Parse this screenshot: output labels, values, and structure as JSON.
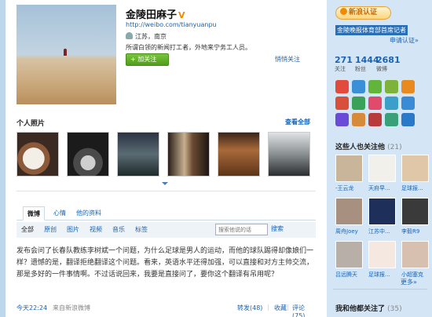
{
  "profile": {
    "name": "金陵田麻子",
    "verified_mark": "V",
    "url": "http://weibo.com/tianyuanpu",
    "location": "江苏，南京",
    "bio": "所谓白领的新闻打工者，外地来宁务工人员。",
    "follow_label": "+ 加关注",
    "report_label": "悄悄关注"
  },
  "photos": {
    "title": "个人照片",
    "view_all": "查看全部"
  },
  "tabs": [
    {
      "label": "微博"
    },
    {
      "label": "心情"
    },
    {
      "label": "他的资料"
    }
  ],
  "filters": [
    {
      "label": "全部"
    },
    {
      "label": "原创"
    },
    {
      "label": "图片"
    },
    {
      "label": "视频"
    },
    {
      "label": "音乐"
    },
    {
      "label": "标签"
    }
  ],
  "search": {
    "placeholder": "搜索他说的话",
    "button": "搜索"
  },
  "post": {
    "text": "发布会问了长春队教练李树斌一个问题，为什么足球是男人的运动，而他的球队踢得却像娘们一样？遗憾的是，翻译拒绝翻译这个问题。看来，英语水平还得加强，可以直接和对方主帅交流，那是多好的一件事情啊。不过话说回来，我要是直接问了，要你这个翻译有吊用呢？",
    "time": "今天22:24",
    "via": "来自新浪微博",
    "forward": "转发(48)",
    "sep1": "|",
    "favorite": "收藏",
    "sep2": "|",
    "comment": "评论(75)"
  },
  "sidebar": {
    "verify_label": "新浪认证",
    "org": "金陵晚报体育部首席记者",
    "apply": "申请认证»",
    "stats": [
      {
        "value": "271",
        "label": "关注"
      },
      {
        "value": "1444",
        "label": "粉丝"
      },
      {
        "value": "2681",
        "label": "微博"
      }
    ],
    "app_icons": [
      {
        "name": "weibo-icon",
        "color": "#e14a3c"
      },
      {
        "name": "music-icon",
        "color": "#3b8fd6"
      },
      {
        "name": "vote-icon",
        "color": "#62b43a"
      },
      {
        "name": "mobile-icon",
        "color": "#7fb23a"
      },
      {
        "name": "photo-icon",
        "color": "#e88a1f"
      },
      {
        "name": "gift-icon",
        "color": "#d84f3a"
      },
      {
        "name": "game-icon",
        "color": "#3aa15a"
      },
      {
        "name": "apps-icon",
        "color": "#e14a6a"
      },
      {
        "name": "chat-icon",
        "color": "#3aa0c8"
      },
      {
        "name": "news-icon",
        "color": "#3a8bd6"
      },
      {
        "name": "video-icon",
        "color": "#6a4ad6"
      },
      {
        "name": "book-icon",
        "color": "#d68a3a"
      },
      {
        "name": "map-icon",
        "color": "#b83a3a"
      },
      {
        "name": "tool-icon",
        "color": "#3aa07a"
      },
      {
        "name": "group-icon",
        "color": "#2a78c8"
      }
    ],
    "people_title": "这些人也关注他",
    "people_count": "(21)",
    "people": [
      {
        "name": "-王云龙",
        "bg": "#c9b59a"
      },
      {
        "name": "天府早...",
        "bg": "#f2f0ea"
      },
      {
        "name": "足球报...",
        "bg": "#e0c7a8"
      },
      {
        "name": "周舟Joey",
        "bg": "#a89080"
      },
      {
        "name": "江苏中...",
        "bg": "#1e2f5a"
      },
      {
        "name": "李毅R9",
        "bg": "#3a3a3a"
      },
      {
        "name": "吕远腾天",
        "bg": "#b8b0a8"
      },
      {
        "name": "足球报...",
        "bg": "#f4e8e0"
      },
      {
        "name": "小超塞克",
        "bg": "#d8c0b0"
      }
    ],
    "more": "更多»",
    "bottom_title": "我和他都关注了",
    "bottom_count": "(35)"
  }
}
